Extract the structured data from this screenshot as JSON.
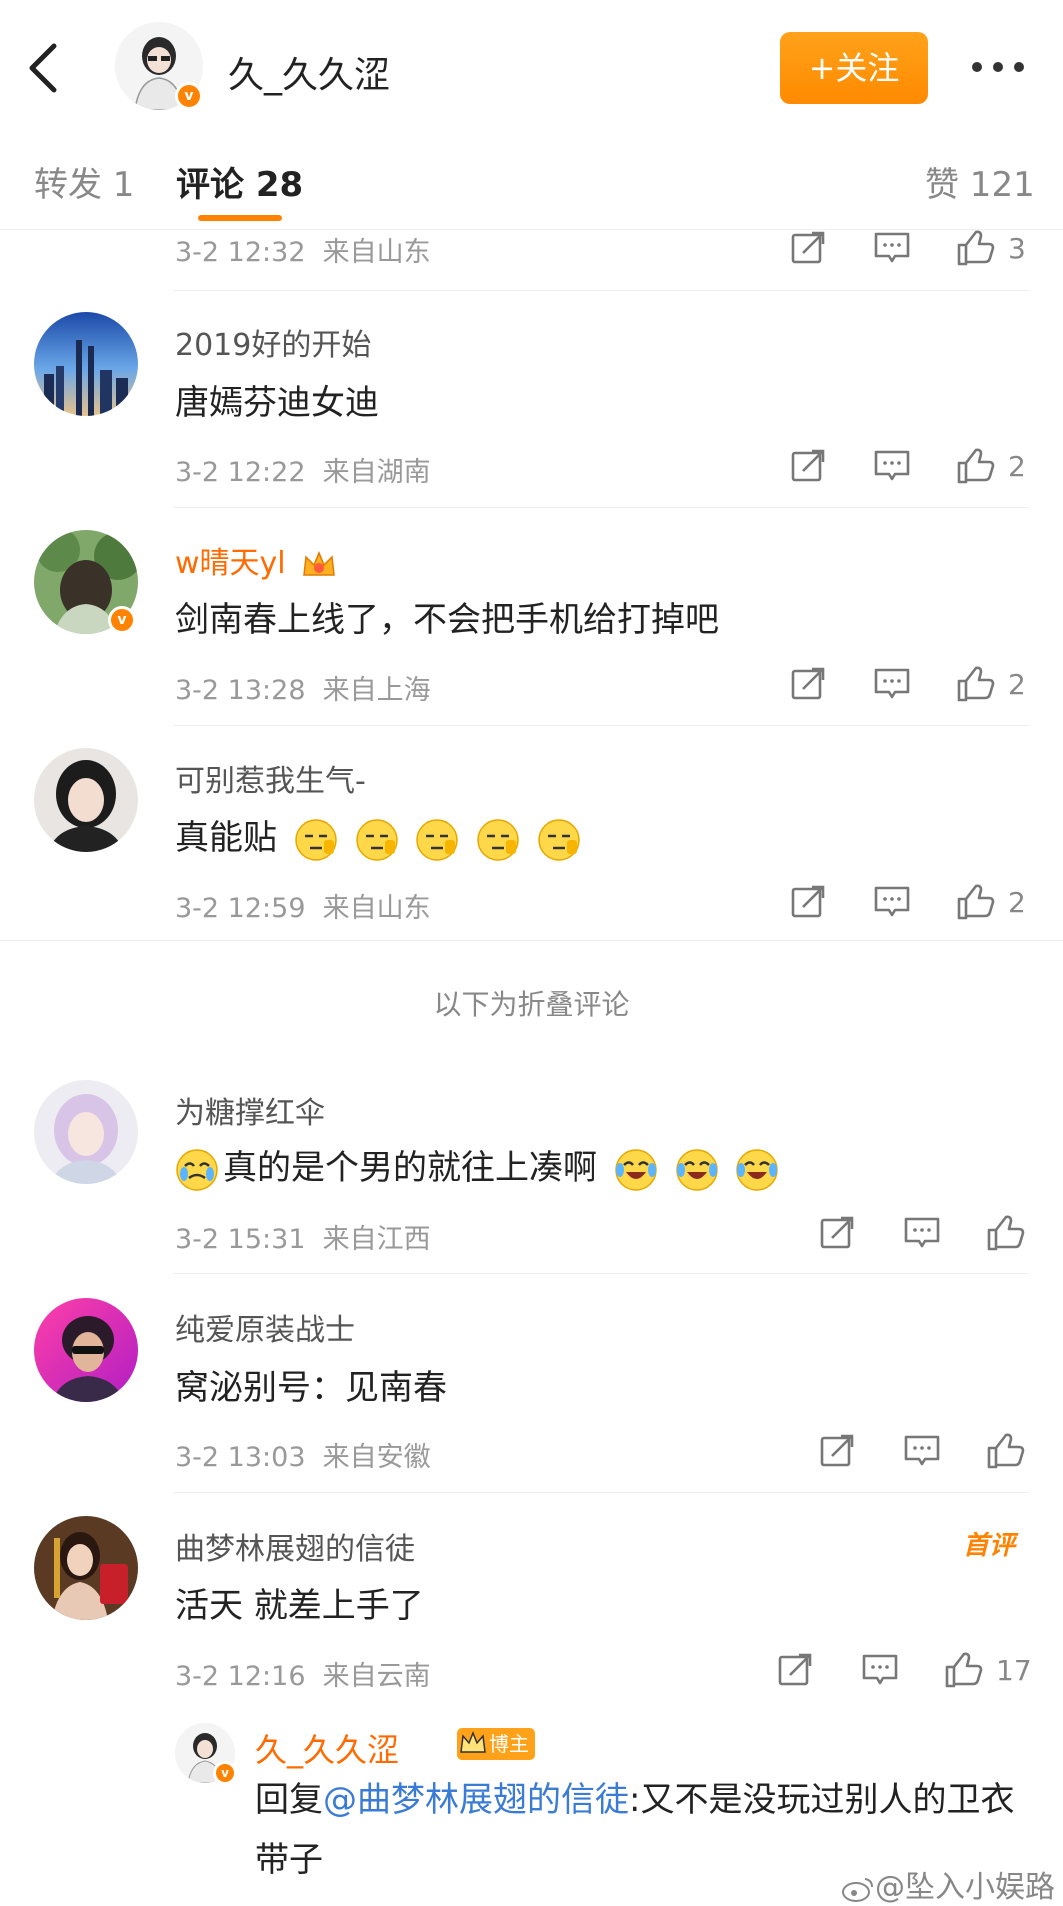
{
  "header": {
    "title": "久_久久涩",
    "follow_label": "+关注"
  },
  "tabs": [
    {
      "label": "转发 1"
    },
    {
      "label": "评论 28"
    },
    {
      "label": "赞 121"
    }
  ],
  "comments": [
    {
      "time": "3-2 12:32",
      "location": "来自山东",
      "likes": "3"
    },
    {
      "user": "2019好的开始",
      "text": "唐嫣芬迪女迪",
      "time": "3-2 12:22",
      "location": "来自湖南",
      "likes": "2"
    },
    {
      "user": "w晴天yl",
      "text": "剑南春上线了，不会把手机给打掉吧",
      "time": "3-2 13:28",
      "location": "来自上海",
      "likes": "2"
    },
    {
      "user": "可别惹我生气-",
      "text": "真能贴",
      "time": "3-2 12:59",
      "location": "来自山东",
      "likes": "2"
    },
    {
      "user": "为糖撑红伞",
      "text": "真的是个男的就往上凑啊",
      "time": "3-2 15:31",
      "location": "来自江西"
    },
    {
      "user": "纯爱原装战士",
      "text": "窝泌别号：见南春",
      "time": "3-2 13:03",
      "location": "来自安徽"
    },
    {
      "user": "曲梦林展翅的信徒",
      "text": "活天  就差上手了",
      "time": "3-2 12:16",
      "location": "来自云南",
      "likes": "17",
      "badge": "首评"
    }
  ],
  "folded_label": "以下为折叠评论",
  "reply": {
    "user": "久_久久涩",
    "badge": "博主",
    "prefix": "回复",
    "mention": "@曲梦林展翅的信徒",
    "text": ":又不是没玩过别人的卫衣带子"
  },
  "watermark": "@坠入小娱路",
  "colors": {
    "accent": "#ff8200",
    "link": "#3a7bd5",
    "vip_name": "#ff6b00"
  }
}
